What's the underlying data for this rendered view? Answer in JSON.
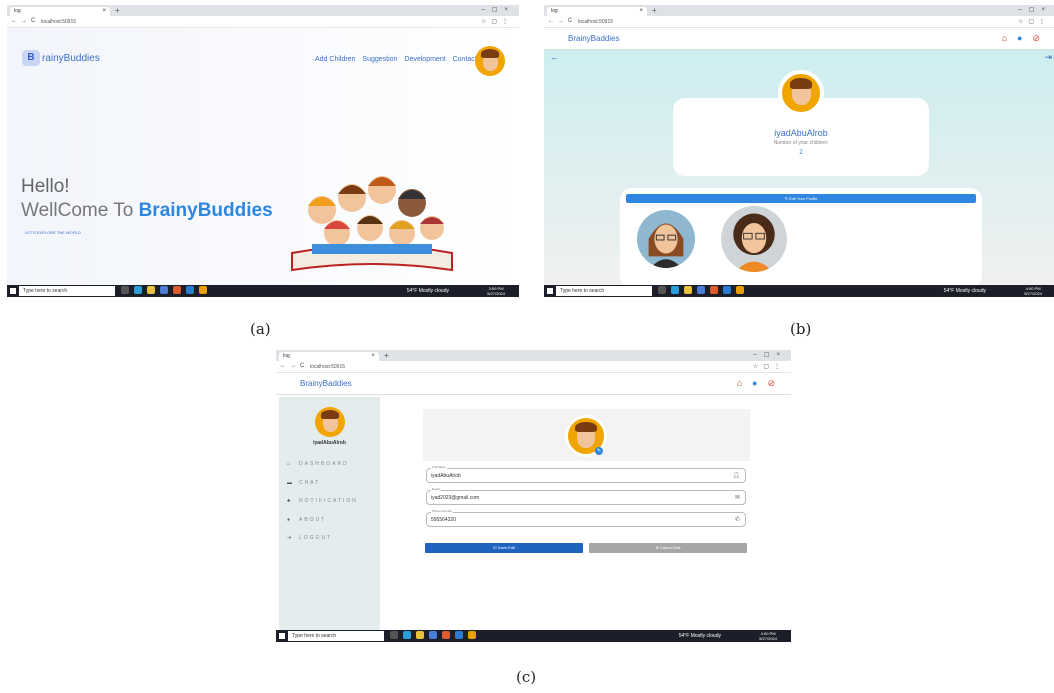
{
  "browser": {
    "tab_title": "log",
    "url": "localhost:50915"
  },
  "taskbar": {
    "search_placeholder": "Type here to search",
    "weather": "54°F  Mostly cloudy",
    "time_a": "3:59 PM",
    "date_a": "5/27/2024",
    "time_b": "4:00 PM",
    "date_b": "5/27/2024",
    "time_c": "4:00 PM",
    "date_c": "5/27/2024"
  },
  "panel_a": {
    "caption": "(a)",
    "logo_letter": "B",
    "logo_text": "rainyBuddies",
    "nav": [
      "Add Children",
      "Suggestion",
      "Development",
      "Contact"
    ],
    "hello": "Hello!",
    "welcome_prefix": "WellCome To",
    "welcome_brand": "BrainyBuddies",
    "tagline": "LET'S EXPLORE THE WORLD"
  },
  "panel_b": {
    "caption": "(b)",
    "brand": "BrainyBaddies",
    "user_name": "iyadAbuAlrob",
    "children_label": "Number of your children:",
    "children_count": "2",
    "edit_profile": "Edit Your Profile"
  },
  "panel_c": {
    "caption": "(c)",
    "brand": "BrainyBaddies",
    "user_name": "iyadAbuAlrob",
    "menu": [
      "DASHBOARD",
      "CHAT",
      "NOTIFICATION",
      "ABOUT",
      "LOGOUT"
    ],
    "fields": [
      {
        "label": "Full Name",
        "value": "iyadAbuAlrob"
      },
      {
        "label": "Email",
        "value": "iyad2023@gmail.com"
      },
      {
        "label": "Phone Number",
        "value": "595564320"
      }
    ],
    "save_label": "Save Edit",
    "cancel_label": "Cancel Edit"
  },
  "colors": {
    "accent": "#2f86e0",
    "save": "#1e63c0",
    "cancel": "#a6a6a6"
  }
}
